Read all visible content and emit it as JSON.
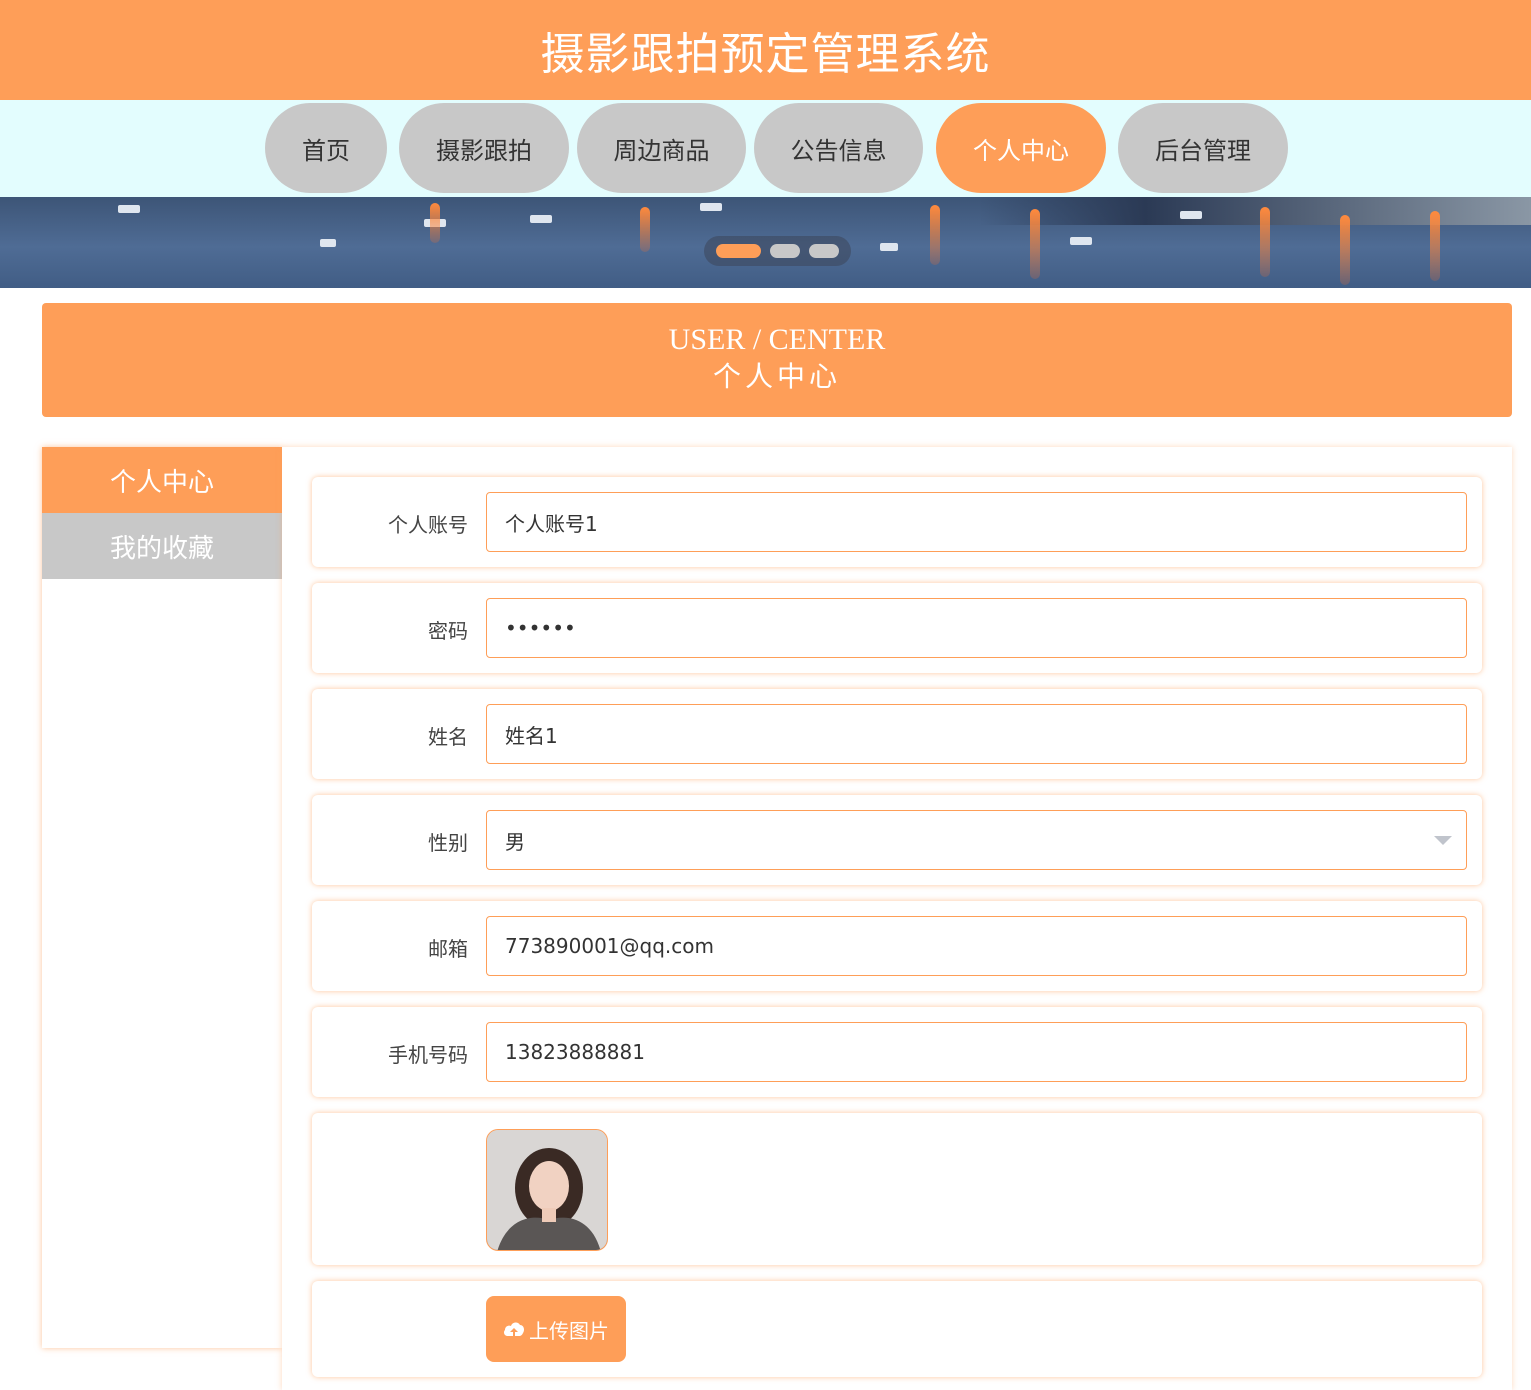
{
  "header": {
    "title": "摄影跟拍预定管理系统"
  },
  "nav": {
    "items": [
      "首页",
      "摄影跟拍",
      "周边商品",
      "公告信息",
      "个人中心",
      "后台管理"
    ],
    "active": "个人中心"
  },
  "section": {
    "title_en": "USER / CENTER",
    "title_cn": "个人中心"
  },
  "sidebar": {
    "items": [
      "个人中心",
      "我的收藏"
    ],
    "active": "个人中心"
  },
  "form": {
    "account": {
      "label": "个人账号",
      "value": "个人账号1"
    },
    "password": {
      "label": "密码",
      "value": "••••••"
    },
    "name": {
      "label": "姓名",
      "value": "姓名1"
    },
    "gender": {
      "label": "性别",
      "value": "男"
    },
    "email": {
      "label": "邮箱",
      "value": "773890001@qq.com"
    },
    "phone": {
      "label": "手机号码",
      "value": "13823888881"
    },
    "upload": {
      "label": "上传图片"
    }
  },
  "colors": {
    "accent": "#fe9e58",
    "inactive": "#c8c8c8",
    "nav_bg": "#e3fdfe"
  }
}
